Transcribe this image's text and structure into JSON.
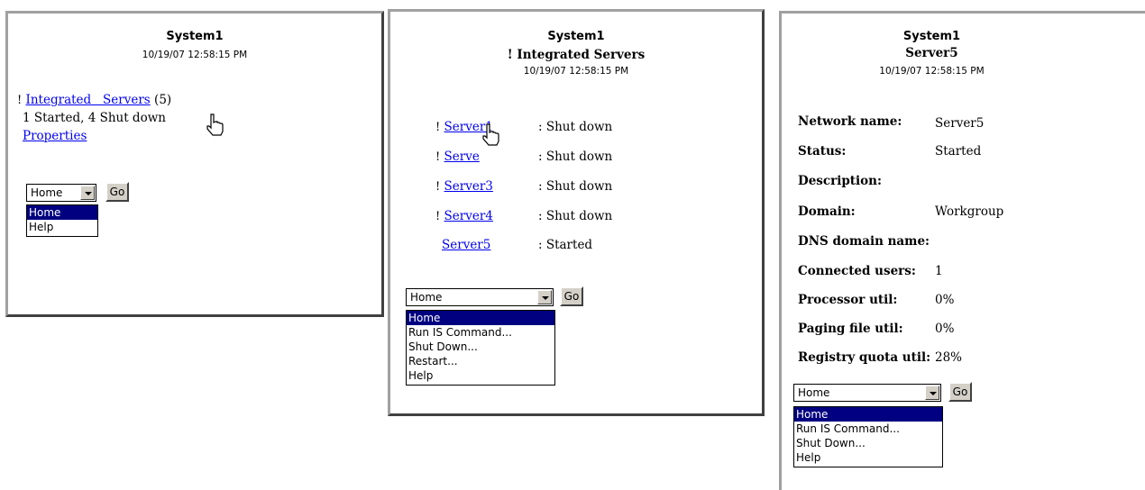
{
  "panel1": {
    "system": "System1",
    "timestamp": "10/19/07 12:58:15 PM",
    "bang": "!",
    "servers_link": "Integrated   Servers",
    "servers_count": "(5)",
    "status_text": "1 Started, 4 Shut down",
    "properties_link": "Properties",
    "select_value": "Home",
    "go_label": "Go",
    "options": [
      "Home",
      "Help"
    ]
  },
  "panel2": {
    "system": "System1",
    "subtitle": "! Integrated  Servers",
    "timestamp": "10/19/07 12:58:15 PM",
    "servers": [
      {
        "bang": "!",
        "name": "Server1",
        "status": ": Shut down"
      },
      {
        "bang": "!",
        "name": "Serve",
        "status": ": Shut down"
      },
      {
        "bang": "!",
        "name": "Server3",
        "status": ": Shut down"
      },
      {
        "bang": "!",
        "name": "Server4",
        "status": ": Shut down"
      },
      {
        "bang": "",
        "name": "Server5",
        "status": ": Started"
      }
    ],
    "select_value": "Home",
    "go_label": "Go",
    "options": [
      "Home",
      "Run IS Command...",
      "Shut Down...",
      "Restart...",
      "Help"
    ]
  },
  "panel3": {
    "system": "System1",
    "subtitle": "Server5",
    "timestamp": "10/19/07 12:58:15 PM",
    "properties": [
      {
        "label": "Network name:",
        "value": "Server5"
      },
      {
        "label": "Status:",
        "value": "Started"
      },
      {
        "label": "Description:",
        "value": ""
      },
      {
        "label": "Domain:",
        "value": "Workgroup"
      },
      {
        "label": "DNS domain name:",
        "value": ""
      },
      {
        "label": "Connected users:",
        "value": "1"
      },
      {
        "label": "Processor util:",
        "value": "0%"
      },
      {
        "label": "Paging file util:",
        "value": "0%"
      },
      {
        "label": "Registry quota util:",
        "value": "28%"
      }
    ],
    "select_value": "Home",
    "go_label": "Go",
    "options": [
      "Home",
      "Run IS Command...",
      "Shut Down...",
      "Help"
    ]
  },
  "colors": {
    "link": "#0000ee",
    "selected": "#000080",
    "button": "#d4d0c8"
  },
  "icons": [
    "hand-pointer-icon",
    "dropdown-arrow-icon"
  ]
}
